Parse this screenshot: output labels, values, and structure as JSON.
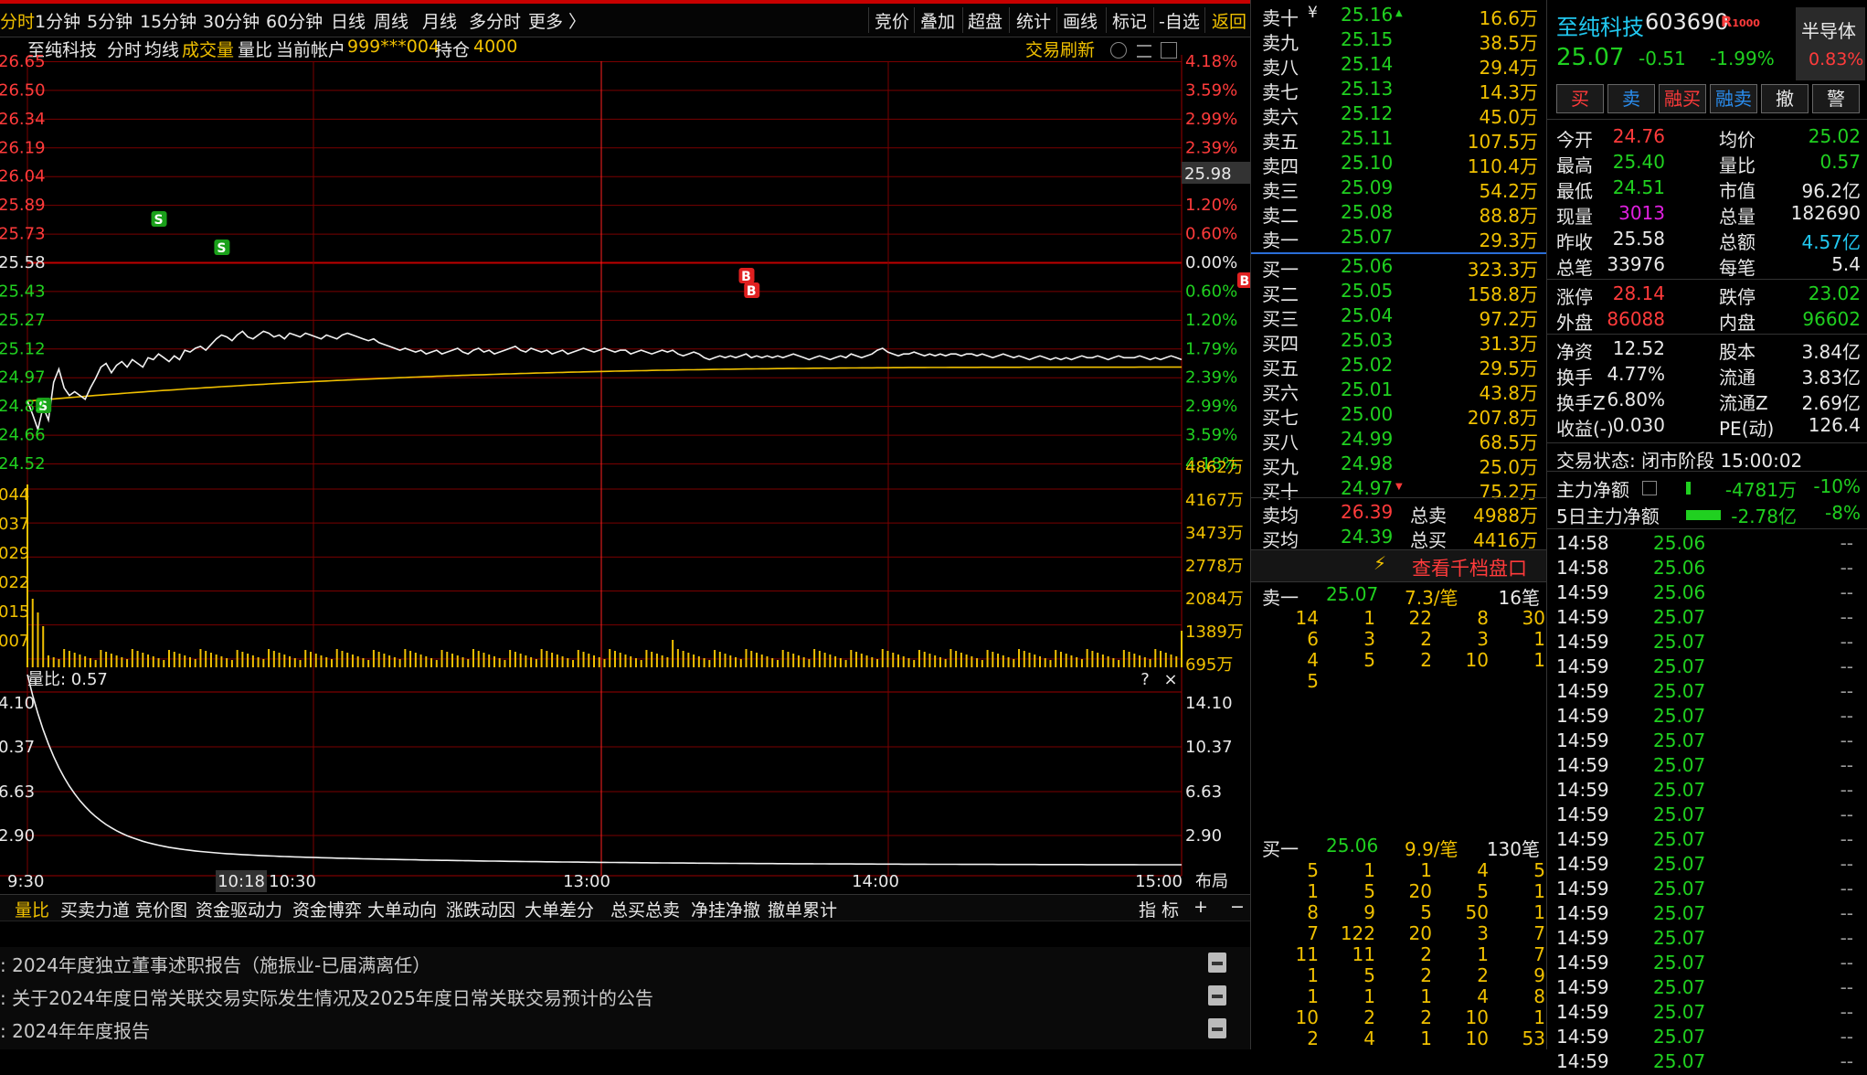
{
  "toolbar": {
    "left_items": [
      "分时",
      "1分钟",
      "5分钟",
      "15分钟",
      "30分钟",
      "60分钟",
      "日线",
      "周线",
      "月线",
      "多分时",
      "更多 〉"
    ],
    "right_items": [
      "竞价",
      "叠加",
      "超盘",
      "统计",
      "画线",
      "标记",
      "-自选",
      "返回"
    ]
  },
  "infobar": {
    "stock_name": "至纯科技",
    "mode": "分时",
    "avg_line_label": "均线",
    "volume_label": "成交量",
    "vol_ratio_label": "量比",
    "account_label": "当前帐户",
    "account_id": "999***004",
    "position_label": "持仓",
    "position_value": "4000",
    "refresh_label": "交易刷新"
  },
  "chart": {
    "price_left_labels": [
      "26.65",
      "26.50",
      "26.34",
      "26.19",
      "26.04",
      "25.89",
      "25.73",
      "25.58",
      "25.43",
      "25.27",
      "25.12",
      "24.97",
      "24.82",
      "24.66",
      "24.52"
    ],
    "pct_right_labels": [
      "4.18%",
      "3.59%",
      "2.99%",
      "2.39%",
      "1.79%",
      "1.20%",
      "0.60%",
      "0.00%",
      "0.60%",
      "1.20%",
      "1.79%",
      "2.39%",
      "2.99%",
      "3.59%",
      "4.18%"
    ],
    "cursor_price": "25.98",
    "volume_left_labels": [
      "044",
      "037",
      "029",
      "022",
      "015",
      "007"
    ],
    "volume_right_labels": [
      "4862万",
      "4167万",
      "3473万",
      "2778万",
      "2084万",
      "1389万",
      "695万"
    ],
    "volratio_title": "量比: 0.57",
    "volratio_left_labels": [
      "4.10",
      "0.37",
      "6.63",
      "2.90"
    ],
    "volratio_right_labels": [
      "14.10",
      "10.37",
      "6.63",
      "2.90"
    ],
    "help_icon": "?",
    "close_icon": "×",
    "time_labels": [
      "9:30",
      "10:30",
      "13:00",
      "14:00",
      "15:00"
    ],
    "cursor_time": "10:18",
    "layout_label": "布局",
    "trade_marks": [
      {
        "type": "S",
        "time_index": 3
      },
      {
        "type": "S",
        "time_index": 25
      },
      {
        "type": "S",
        "time_index": 37
      },
      {
        "type": "B",
        "time_index": 137
      },
      {
        "type": "B",
        "time_index": 138
      },
      {
        "type": "B",
        "time_index": 232
      }
    ],
    "price_series": [
      24.85,
      24.78,
      24.7,
      24.82,
      24.75,
      24.95,
      25.02,
      24.92,
      24.88,
      24.9,
      24.88,
      24.86,
      24.92,
      24.97,
      25.03,
      25.05,
      25.0,
      25.04,
      25.06,
      25.03,
      25.07,
      25.05,
      25.03,
      25.08,
      25.07,
      25.1,
      25.08,
      25.06,
      25.09,
      25.07,
      25.12,
      25.11,
      25.13,
      25.14,
      25.12,
      25.15,
      25.18,
      25.2,
      25.19,
      25.17,
      25.2,
      25.22,
      25.19,
      25.18,
      25.2,
      25.22,
      25.21,
      25.19,
      25.2,
      25.18,
      25.21,
      25.2,
      25.19,
      25.21,
      25.2,
      25.19,
      25.18,
      25.2,
      25.19,
      25.18,
      25.2,
      25.21,
      25.2,
      25.19,
      25.18,
      25.17,
      25.18,
      25.16,
      25.15,
      25.14,
      25.13,
      25.12,
      25.13,
      25.12,
      25.11,
      25.12,
      25.1,
      25.11,
      25.12,
      25.1,
      25.11,
      25.12,
      25.13,
      25.11,
      25.1,
      25.12,
      25.13,
      25.11,
      25.12,
      25.1,
      25.11,
      25.12,
      25.13,
      25.14,
      25.12,
      25.11,
      25.13,
      25.12,
      25.11,
      25.12,
      25.1,
      25.11,
      25.12,
      25.1,
      25.11,
      25.12,
      25.13,
      25.12,
      25.11,
      25.12,
      25.13,
      25.12,
      25.11,
      25.12,
      25.12,
      25.1,
      25.11,
      25.12,
      25.11,
      25.1,
      25.11,
      25.12,
      25.11,
      25.12,
      25.1,
      25.09,
      25.1,
      25.11,
      25.1,
      25.08,
      25.07,
      25.08,
      25.09,
      25.08,
      25.09,
      25.08,
      25.09,
      25.1,
      25.08,
      25.09,
      25.08,
      25.09,
      25.08,
      25.09,
      25.08,
      25.09,
      25.1,
      25.09,
      25.08,
      25.07,
      25.08,
      25.09,
      25.08,
      25.07,
      25.08,
      25.09,
      25.08,
      25.1,
      25.09,
      25.08,
      25.09,
      25.1,
      25.12,
      25.13,
      25.11,
      25.1,
      25.09,
      25.1,
      25.1,
      25.11,
      25.1,
      25.09,
      25.1,
      25.09,
      25.1,
      25.09,
      25.1,
      25.1,
      25.09,
      25.1,
      25.1,
      25.09,
      25.1,
      25.09,
      25.08,
      25.09,
      25.1,
      25.09,
      25.08,
      25.09,
      25.08,
      25.07,
      25.08,
      25.09,
      25.08,
      25.07,
      25.08,
      25.07,
      25.08,
      25.07,
      25.08,
      25.09,
      25.08,
      25.08,
      25.09,
      25.08,
      25.07,
      25.08,
      25.09,
      25.08,
      25.08,
      25.08,
      25.09,
      25.08,
      25.07,
      25.08,
      25.07,
      25.08,
      25.09,
      25.08,
      25.07
    ],
    "avg_series_start": 24.85,
    "avg_series_end": 25.03
  },
  "bottom_tabs": [
    "量比",
    "买卖力道",
    "竞价图",
    "资金驱动力",
    "资金博弈",
    "大单动向",
    "涨跌动因",
    "大单差分",
    "总买总卖",
    "净挂净撤",
    "撤单累计"
  ],
  "bottom_right": {
    "indicator": "指 标",
    "plus": "+",
    "minus": "−"
  },
  "news": [
    "2024年度独立董事述职报告（施振业-已届满离任）",
    "关于2024年度日常关联交易实际发生情况及2025年度日常关联交易预计的公告",
    "2024年年度报告"
  ],
  "orderbook": {
    "asks": [
      {
        "label": "卖十",
        "price": "25.16",
        "vol": "16.6万"
      },
      {
        "label": "卖九",
        "price": "25.15",
        "vol": "38.5万"
      },
      {
        "label": "卖八",
        "price": "25.14",
        "vol": "29.4万"
      },
      {
        "label": "卖七",
        "price": "25.13",
        "vol": "14.3万"
      },
      {
        "label": "卖六",
        "price": "25.12",
        "vol": "45.0万"
      },
      {
        "label": "卖五",
        "price": "25.11",
        "vol": "107.5万"
      },
      {
        "label": "卖四",
        "price": "25.10",
        "vol": "110.4万"
      },
      {
        "label": "卖三",
        "price": "25.09",
        "vol": "54.2万"
      },
      {
        "label": "卖二",
        "price": "25.08",
        "vol": "88.8万"
      },
      {
        "label": "卖一",
        "price": "25.07",
        "vol": "29.3万"
      }
    ],
    "bids": [
      {
        "label": "买一",
        "price": "25.06",
        "vol": "323.3万"
      },
      {
        "label": "买二",
        "price": "25.05",
        "vol": "158.8万"
      },
      {
        "label": "买三",
        "price": "25.04",
        "vol": "97.2万"
      },
      {
        "label": "买四",
        "price": "25.03",
        "vol": "31.3万"
      },
      {
        "label": "买五",
        "price": "25.02",
        "vol": "29.5万"
      },
      {
        "label": "买六",
        "price": "25.01",
        "vol": "43.8万"
      },
      {
        "label": "买七",
        "price": "25.00",
        "vol": "207.8万"
      },
      {
        "label": "买八",
        "price": "24.99",
        "vol": "68.5万"
      },
      {
        "label": "买九",
        "price": "24.98",
        "vol": "25.0万"
      },
      {
        "label": "买十",
        "price": "24.97",
        "vol": "75.2万"
      }
    ],
    "ask_avg_label": "卖均",
    "ask_avg": "26.39",
    "ask_total_label": "总卖",
    "ask_total": "4988万",
    "bid_avg_label": "买均",
    "bid_avg": "24.39",
    "bid_total_label": "总买",
    "bid_total": "4416万",
    "qiandang_label": "查看千档盘口",
    "ask1_detail": {
      "label": "卖一",
      "price": "25.07",
      "per": "7.3/笔",
      "count": "16笔"
    },
    "ask1_queue": [
      [
        "14",
        "1",
        "22",
        "8",
        "30"
      ],
      [
        "6",
        "3",
        "2",
        "3",
        "1"
      ],
      [
        "4",
        "5",
        "2",
        "10",
        "1"
      ],
      [
        "5",
        "",
        "",
        "",
        ""
      ]
    ],
    "bid1_detail": {
      "label": "买一",
      "price": "25.06",
      "per": "9.9/笔",
      "count": "130笔"
    },
    "bid1_queue": [
      [
        "5",
        "1",
        "1",
        "4",
        "5"
      ],
      [
        "1",
        "5",
        "20",
        "5",
        "1"
      ],
      [
        "8",
        "9",
        "5",
        "50",
        "1"
      ],
      [
        "7",
        "122",
        "20",
        "3",
        "7"
      ],
      [
        "11",
        "11",
        "2",
        "1",
        "7"
      ],
      [
        "1",
        "5",
        "2",
        "2",
        "9"
      ],
      [
        "1",
        "1",
        "1",
        "4",
        "8"
      ],
      [
        "10",
        "2",
        "2",
        "10",
        "1"
      ],
      [
        "2",
        "4",
        "1",
        "10",
        "53"
      ]
    ]
  },
  "quote": {
    "name": "至纯科技",
    "code": "603690",
    "tag": "R",
    "tag_sub": "1000",
    "sector": "半导体",
    "price": "25.07",
    "change": "-0.51",
    "change_pct": "-1.99%",
    "sector_pct": "0.83%",
    "buttons": [
      "买",
      "卖",
      "融买",
      "融卖",
      "撤",
      "警"
    ],
    "stats": [
      [
        {
          "l": "今开",
          "v": "24.76",
          "c": "red"
        },
        {
          "l": "均价",
          "v": "25.02",
          "c": "green"
        }
      ],
      [
        {
          "l": "最高",
          "v": "25.40",
          "c": "green"
        },
        {
          "l": "量比",
          "v": "0.57",
          "c": "green"
        }
      ],
      [
        {
          "l": "最低",
          "v": "24.51",
          "c": "green"
        },
        {
          "l": "市值",
          "v": "96.2亿",
          "c": "white"
        }
      ],
      [
        {
          "l": "现量",
          "v": "3013",
          "c": "magenta"
        },
        {
          "l": "总量",
          "v": "182690",
          "c": "white"
        }
      ],
      [
        {
          "l": "昨收",
          "v": "25.58",
          "c": "white"
        },
        {
          "l": "总额",
          "v": "4.57亿",
          "c": "cyan"
        }
      ],
      [
        {
          "l": "总笔",
          "v": "33976",
          "c": "white"
        },
        {
          "l": "每笔",
          "v": "5.4",
          "c": "white"
        }
      ],
      [
        {
          "l": "涨停",
          "v": "28.14",
          "c": "red"
        },
        {
          "l": "跌停",
          "v": "23.02",
          "c": "green"
        }
      ],
      [
        {
          "l": "外盘",
          "v": "86088",
          "c": "red"
        },
        {
          "l": "内盘",
          "v": "96602",
          "c": "green"
        }
      ],
      [
        {
          "l": "净资",
          "v": "12.52",
          "c": "white"
        },
        {
          "l": "股本",
          "v": "3.84亿",
          "c": "white"
        }
      ],
      [
        {
          "l": "换手",
          "v": "4.77%",
          "c": "white"
        },
        {
          "l": "流通",
          "v": "3.83亿",
          "c": "white"
        }
      ],
      [
        {
          "l": "换手Z",
          "v": "6.80%",
          "c": "white"
        },
        {
          "l": "流通Z",
          "v": "2.69亿",
          "c": "white"
        }
      ],
      [
        {
          "l": "收益(-)",
          "v": "0.030",
          "c": "white"
        },
        {
          "l": "PE(动)",
          "v": "126.4",
          "c": "white"
        }
      ]
    ],
    "trade_status": "交易状态: 闭市阶段 15:00:02",
    "main_net_label": "主力净额",
    "main_net": "-4781万",
    "main_net_pct": "-10%",
    "main5_label": "5日主力净额",
    "main5": "-2.78亿",
    "main5_pct": "-8%",
    "ticks": [
      {
        "t": "14:58",
        "p": "25.06",
        "v": "--"
      },
      {
        "t": "14:58",
        "p": "25.06",
        "v": "--"
      },
      {
        "t": "14:59",
        "p": "25.06",
        "v": "--"
      },
      {
        "t": "14:59",
        "p": "25.07",
        "v": "--"
      },
      {
        "t": "14:59",
        "p": "25.07",
        "v": "--"
      },
      {
        "t": "14:59",
        "p": "25.07",
        "v": "--"
      },
      {
        "t": "14:59",
        "p": "25.07",
        "v": "--"
      },
      {
        "t": "14:59",
        "p": "25.07",
        "v": "--"
      },
      {
        "t": "14:59",
        "p": "25.07",
        "v": "--"
      },
      {
        "t": "14:59",
        "p": "25.07",
        "v": "--"
      },
      {
        "t": "14:59",
        "p": "25.07",
        "v": "--"
      },
      {
        "t": "14:59",
        "p": "25.07",
        "v": "--"
      },
      {
        "t": "14:59",
        "p": "25.07",
        "v": "--"
      },
      {
        "t": "14:59",
        "p": "25.07",
        "v": "--"
      },
      {
        "t": "14:59",
        "p": "25.07",
        "v": "--"
      },
      {
        "t": "14:59",
        "p": "25.07",
        "v": "--"
      },
      {
        "t": "14:59",
        "p": "25.07",
        "v": "--"
      },
      {
        "t": "14:59",
        "p": "25.07",
        "v": "--"
      },
      {
        "t": "14:59",
        "p": "25.07",
        "v": "--"
      },
      {
        "t": "14:59",
        "p": "25.07",
        "v": "--"
      },
      {
        "t": "14:59",
        "p": "25.07",
        "v": "--"
      },
      {
        "t": "14:59",
        "p": "25.07",
        "v": "--"
      }
    ]
  },
  "colors": {
    "up": "#ff3b3b",
    "down": "#20d020",
    "accent": "#f0c000",
    "grid": "#8b0000",
    "bg": "#000000"
  }
}
